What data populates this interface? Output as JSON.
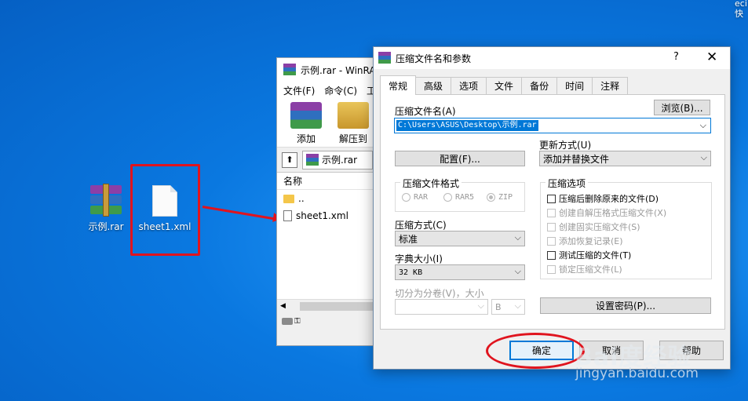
{
  "desktop": {
    "icons": [
      {
        "label": "示例.rar"
      },
      {
        "label": "sheet1.xml"
      }
    ],
    "corner_text": [
      "eci",
      "快"
    ]
  },
  "winrar": {
    "title": "示例.rar - WinRA",
    "menu": [
      "文件(F)",
      "命令(C)",
      "工"
    ],
    "toolbar": [
      "添加",
      "解压到"
    ],
    "address": "示例.rar",
    "column_name": "名称",
    "files": [
      "..",
      "sheet1.xml"
    ]
  },
  "dialog": {
    "title": "压缩文件名和参数",
    "help": "?",
    "close": "✕",
    "tabs": [
      "常规",
      "高级",
      "选项",
      "文件",
      "备份",
      "时间",
      "注释"
    ],
    "archive_name_label": "压缩文件名(A)",
    "browse_button": "浏览(B)...",
    "archive_name_value": "C:\\Users\\ASUS\\Desktop\\示例.rar",
    "profile_button": "配置(F)...",
    "update_mode_label": "更新方式(U)",
    "update_mode_value": "添加并替换文件",
    "format_group": "压缩文件格式",
    "formats": [
      "RAR",
      "RAR5",
      "ZIP"
    ],
    "method_label": "压缩方式(C)",
    "method_value": "标准",
    "dict_label": "字典大小(I)",
    "dict_value": "32 KB",
    "split_label": "切分为分卷(V)，大小",
    "split_unit": "B",
    "options_group": "压缩选项",
    "options": [
      {
        "label": "压缩后删除原来的文件(D)",
        "enabled": true
      },
      {
        "label": "创建自解压格式压缩文件(X)",
        "enabled": false
      },
      {
        "label": "创建固实压缩文件(S)",
        "enabled": false
      },
      {
        "label": "添加恢复记录(E)",
        "enabled": false
      },
      {
        "label": "测试压缩的文件(T)",
        "enabled": true
      },
      {
        "label": "锁定压缩文件(L)",
        "enabled": false
      }
    ],
    "password_button": "设置密码(P)...",
    "ok_button": "确定",
    "cancel_button": "取消",
    "help_button": "帮助"
  },
  "watermark": {
    "main": "Bai度经验",
    "url": "jingyan.baidu.com"
  },
  "colors": {
    "desktop": "#0a78e0",
    "annotation_red": "#e0141e",
    "selection_blue": "#0078d7"
  }
}
